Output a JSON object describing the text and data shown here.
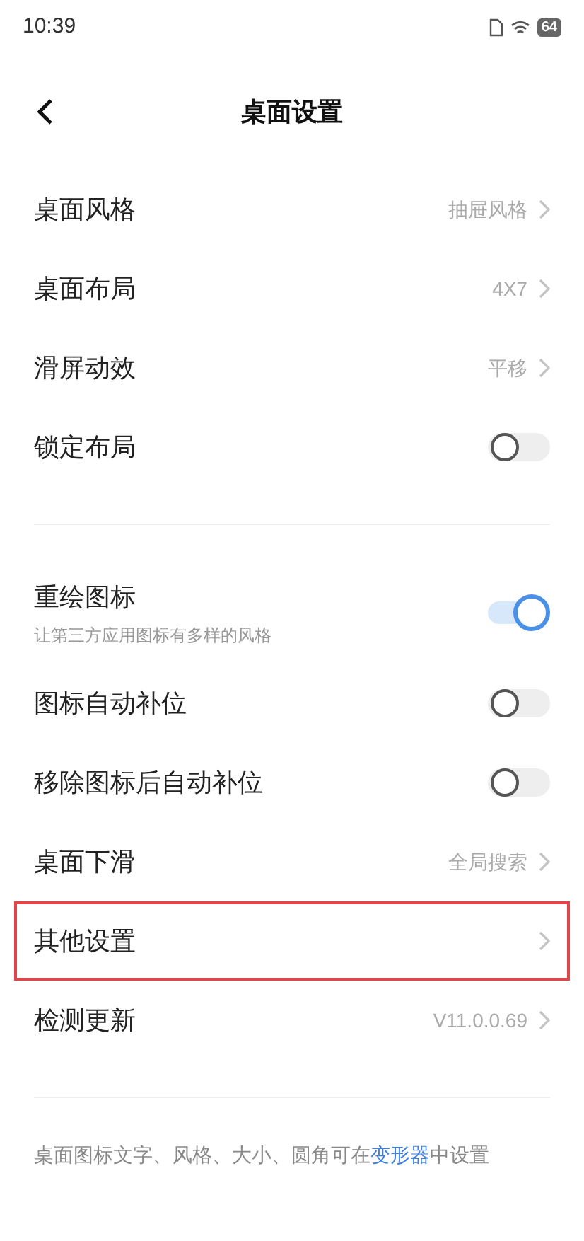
{
  "status_bar": {
    "time": "10:39",
    "battery": "64"
  },
  "header": {
    "title": "桌面设置"
  },
  "groups": [
    {
      "items": [
        {
          "kind": "link",
          "label": "桌面风格",
          "value": "抽屉风格",
          "highlighted": false
        },
        {
          "kind": "link",
          "label": "桌面布局",
          "value": "4X7",
          "highlighted": false
        },
        {
          "kind": "link",
          "label": "滑屏动效",
          "value": "平移",
          "highlighted": false
        },
        {
          "kind": "toggle",
          "label": "锁定布局",
          "on": false,
          "highlighted": false
        }
      ]
    },
    {
      "items": [
        {
          "kind": "toggle",
          "label": "重绘图标",
          "subtitle": "让第三方应用图标有多样的风格",
          "on": true,
          "highlighted": false
        },
        {
          "kind": "toggle",
          "label": "图标自动补位",
          "on": false,
          "highlighted": false
        },
        {
          "kind": "toggle",
          "label": "移除图标后自动补位",
          "on": false,
          "highlighted": false
        },
        {
          "kind": "link",
          "label": "桌面下滑",
          "value": "全局搜索",
          "highlighted": false
        },
        {
          "kind": "link",
          "label": "其他设置",
          "highlighted": true
        },
        {
          "kind": "link",
          "label": "检测更新",
          "value": "V11.0.0.69",
          "highlighted": false
        }
      ]
    }
  ],
  "footer": {
    "before": "桌面图标文字、风格、大小、圆角可在",
    "link": "变形器",
    "after": "中设置"
  }
}
